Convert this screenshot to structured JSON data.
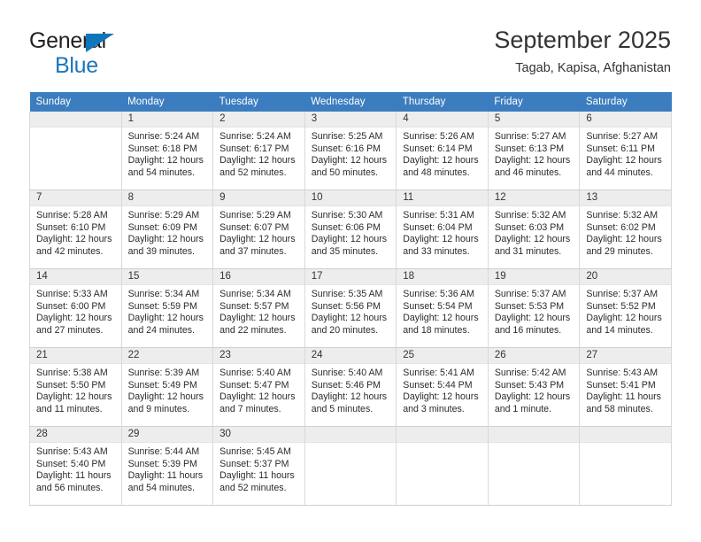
{
  "brand": {
    "name_part1": "General",
    "name_part2": "Blue",
    "triangle_color": "#1076bc",
    "text_color_1": "#231f20",
    "text_color_2": "#1b75bb"
  },
  "header": {
    "title": "September 2025",
    "subtitle": "Tagab, Kapisa, Afghanistan"
  },
  "theme": {
    "header_row_bg": "#3c7dbf",
    "header_row_text": "#ffffff",
    "daynum_strip_bg": "#ededed",
    "cell_bg": "#ffffff",
    "border_color": "#d9d9d9"
  },
  "weekdays": [
    "Sunday",
    "Monday",
    "Tuesday",
    "Wednesday",
    "Thursday",
    "Friday",
    "Saturday"
  ],
  "weeks": [
    [
      {
        "day": "",
        "blank": true,
        "sunrise": "",
        "sunset": "",
        "daylight1": "",
        "daylight2": ""
      },
      {
        "day": "1",
        "sunrise": "Sunrise: 5:24 AM",
        "sunset": "Sunset: 6:18 PM",
        "daylight1": "Daylight: 12 hours",
        "daylight2": "and 54 minutes."
      },
      {
        "day": "2",
        "sunrise": "Sunrise: 5:24 AM",
        "sunset": "Sunset: 6:17 PM",
        "daylight1": "Daylight: 12 hours",
        "daylight2": "and 52 minutes."
      },
      {
        "day": "3",
        "sunrise": "Sunrise: 5:25 AM",
        "sunset": "Sunset: 6:16 PM",
        "daylight1": "Daylight: 12 hours",
        "daylight2": "and 50 minutes."
      },
      {
        "day": "4",
        "sunrise": "Sunrise: 5:26 AM",
        "sunset": "Sunset: 6:14 PM",
        "daylight1": "Daylight: 12 hours",
        "daylight2": "and 48 minutes."
      },
      {
        "day": "5",
        "sunrise": "Sunrise: 5:27 AM",
        "sunset": "Sunset: 6:13 PM",
        "daylight1": "Daylight: 12 hours",
        "daylight2": "and 46 minutes."
      },
      {
        "day": "6",
        "sunrise": "Sunrise: 5:27 AM",
        "sunset": "Sunset: 6:11 PM",
        "daylight1": "Daylight: 12 hours",
        "daylight2": "and 44 minutes."
      }
    ],
    [
      {
        "day": "7",
        "sunrise": "Sunrise: 5:28 AM",
        "sunset": "Sunset: 6:10 PM",
        "daylight1": "Daylight: 12 hours",
        "daylight2": "and 42 minutes."
      },
      {
        "day": "8",
        "sunrise": "Sunrise: 5:29 AM",
        "sunset": "Sunset: 6:09 PM",
        "daylight1": "Daylight: 12 hours",
        "daylight2": "and 39 minutes."
      },
      {
        "day": "9",
        "sunrise": "Sunrise: 5:29 AM",
        "sunset": "Sunset: 6:07 PM",
        "daylight1": "Daylight: 12 hours",
        "daylight2": "and 37 minutes."
      },
      {
        "day": "10",
        "sunrise": "Sunrise: 5:30 AM",
        "sunset": "Sunset: 6:06 PM",
        "daylight1": "Daylight: 12 hours",
        "daylight2": "and 35 minutes."
      },
      {
        "day": "11",
        "sunrise": "Sunrise: 5:31 AM",
        "sunset": "Sunset: 6:04 PM",
        "daylight1": "Daylight: 12 hours",
        "daylight2": "and 33 minutes."
      },
      {
        "day": "12",
        "sunrise": "Sunrise: 5:32 AM",
        "sunset": "Sunset: 6:03 PM",
        "daylight1": "Daylight: 12 hours",
        "daylight2": "and 31 minutes."
      },
      {
        "day": "13",
        "sunrise": "Sunrise: 5:32 AM",
        "sunset": "Sunset: 6:02 PM",
        "daylight1": "Daylight: 12 hours",
        "daylight2": "and 29 minutes."
      }
    ],
    [
      {
        "day": "14",
        "sunrise": "Sunrise: 5:33 AM",
        "sunset": "Sunset: 6:00 PM",
        "daylight1": "Daylight: 12 hours",
        "daylight2": "and 27 minutes."
      },
      {
        "day": "15",
        "sunrise": "Sunrise: 5:34 AM",
        "sunset": "Sunset: 5:59 PM",
        "daylight1": "Daylight: 12 hours",
        "daylight2": "and 24 minutes."
      },
      {
        "day": "16",
        "sunrise": "Sunrise: 5:34 AM",
        "sunset": "Sunset: 5:57 PM",
        "daylight1": "Daylight: 12 hours",
        "daylight2": "and 22 minutes."
      },
      {
        "day": "17",
        "sunrise": "Sunrise: 5:35 AM",
        "sunset": "Sunset: 5:56 PM",
        "daylight1": "Daylight: 12 hours",
        "daylight2": "and 20 minutes."
      },
      {
        "day": "18",
        "sunrise": "Sunrise: 5:36 AM",
        "sunset": "Sunset: 5:54 PM",
        "daylight1": "Daylight: 12 hours",
        "daylight2": "and 18 minutes."
      },
      {
        "day": "19",
        "sunrise": "Sunrise: 5:37 AM",
        "sunset": "Sunset: 5:53 PM",
        "daylight1": "Daylight: 12 hours",
        "daylight2": "and 16 minutes."
      },
      {
        "day": "20",
        "sunrise": "Sunrise: 5:37 AM",
        "sunset": "Sunset: 5:52 PM",
        "daylight1": "Daylight: 12 hours",
        "daylight2": "and 14 minutes."
      }
    ],
    [
      {
        "day": "21",
        "sunrise": "Sunrise: 5:38 AM",
        "sunset": "Sunset: 5:50 PM",
        "daylight1": "Daylight: 12 hours",
        "daylight2": "and 11 minutes."
      },
      {
        "day": "22",
        "sunrise": "Sunrise: 5:39 AM",
        "sunset": "Sunset: 5:49 PM",
        "daylight1": "Daylight: 12 hours",
        "daylight2": "and 9 minutes."
      },
      {
        "day": "23",
        "sunrise": "Sunrise: 5:40 AM",
        "sunset": "Sunset: 5:47 PM",
        "daylight1": "Daylight: 12 hours",
        "daylight2": "and 7 minutes."
      },
      {
        "day": "24",
        "sunrise": "Sunrise: 5:40 AM",
        "sunset": "Sunset: 5:46 PM",
        "daylight1": "Daylight: 12 hours",
        "daylight2": "and 5 minutes."
      },
      {
        "day": "25",
        "sunrise": "Sunrise: 5:41 AM",
        "sunset": "Sunset: 5:44 PM",
        "daylight1": "Daylight: 12 hours",
        "daylight2": "and 3 minutes."
      },
      {
        "day": "26",
        "sunrise": "Sunrise: 5:42 AM",
        "sunset": "Sunset: 5:43 PM",
        "daylight1": "Daylight: 12 hours",
        "daylight2": "and 1 minute."
      },
      {
        "day": "27",
        "sunrise": "Sunrise: 5:43 AM",
        "sunset": "Sunset: 5:41 PM",
        "daylight1": "Daylight: 11 hours",
        "daylight2": "and 58 minutes."
      }
    ],
    [
      {
        "day": "28",
        "sunrise": "Sunrise: 5:43 AM",
        "sunset": "Sunset: 5:40 PM",
        "daylight1": "Daylight: 11 hours",
        "daylight2": "and 56 minutes."
      },
      {
        "day": "29",
        "sunrise": "Sunrise: 5:44 AM",
        "sunset": "Sunset: 5:39 PM",
        "daylight1": "Daylight: 11 hours",
        "daylight2": "and 54 minutes."
      },
      {
        "day": "30",
        "sunrise": "Sunrise: 5:45 AM",
        "sunset": "Sunset: 5:37 PM",
        "daylight1": "Daylight: 11 hours",
        "daylight2": "and 52 minutes."
      },
      {
        "day": "",
        "blank": true,
        "sunrise": "",
        "sunset": "",
        "daylight1": "",
        "daylight2": ""
      },
      {
        "day": "",
        "blank": true,
        "sunrise": "",
        "sunset": "",
        "daylight1": "",
        "daylight2": ""
      },
      {
        "day": "",
        "blank": true,
        "sunrise": "",
        "sunset": "",
        "daylight1": "",
        "daylight2": ""
      },
      {
        "day": "",
        "blank": true,
        "sunrise": "",
        "sunset": "",
        "daylight1": "",
        "daylight2": ""
      }
    ]
  ]
}
